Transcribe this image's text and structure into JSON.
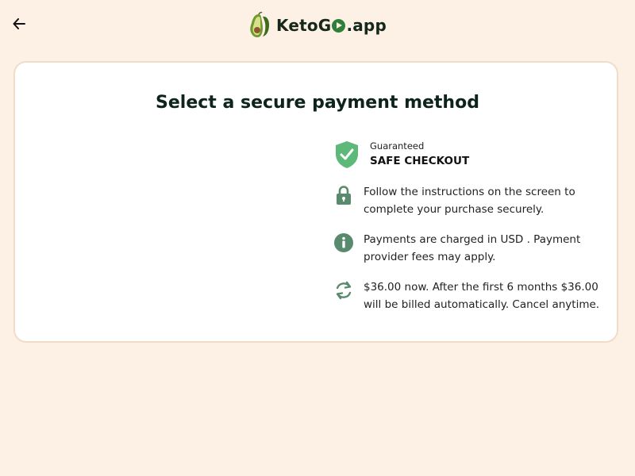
{
  "header": {
    "back_icon": "arrow-left-icon",
    "logo_text_before": "KetoG",
    "logo_text_after": ".app",
    "logo_icon": "avocado-icon",
    "logo_accent_color": "#2f7f3a"
  },
  "card": {
    "title": "Select a secure payment method",
    "guarantee": {
      "icon": "shield-check-icon",
      "small_label": "Guaranteed",
      "big_label": "SAFE CHECKOUT",
      "color": "#5cb97a"
    },
    "items": [
      {
        "icon": "lock-icon",
        "text": "Follow the instructions on the screen to complete your purchase securely."
      },
      {
        "icon": "info-icon",
        "text": "Payments are charged in USD . Payment provider fees may apply."
      },
      {
        "icon": "refresh-icon",
        "text": "$36.00 now. After the first 6 months $36.00 will be billed automatically. Cancel anytime."
      }
    ],
    "icon_color": "#5a8a6e"
  },
  "colors": {
    "page_background": "#fdf1e5",
    "card_border": "#f1dcc8",
    "card_background": "#ffffff"
  }
}
